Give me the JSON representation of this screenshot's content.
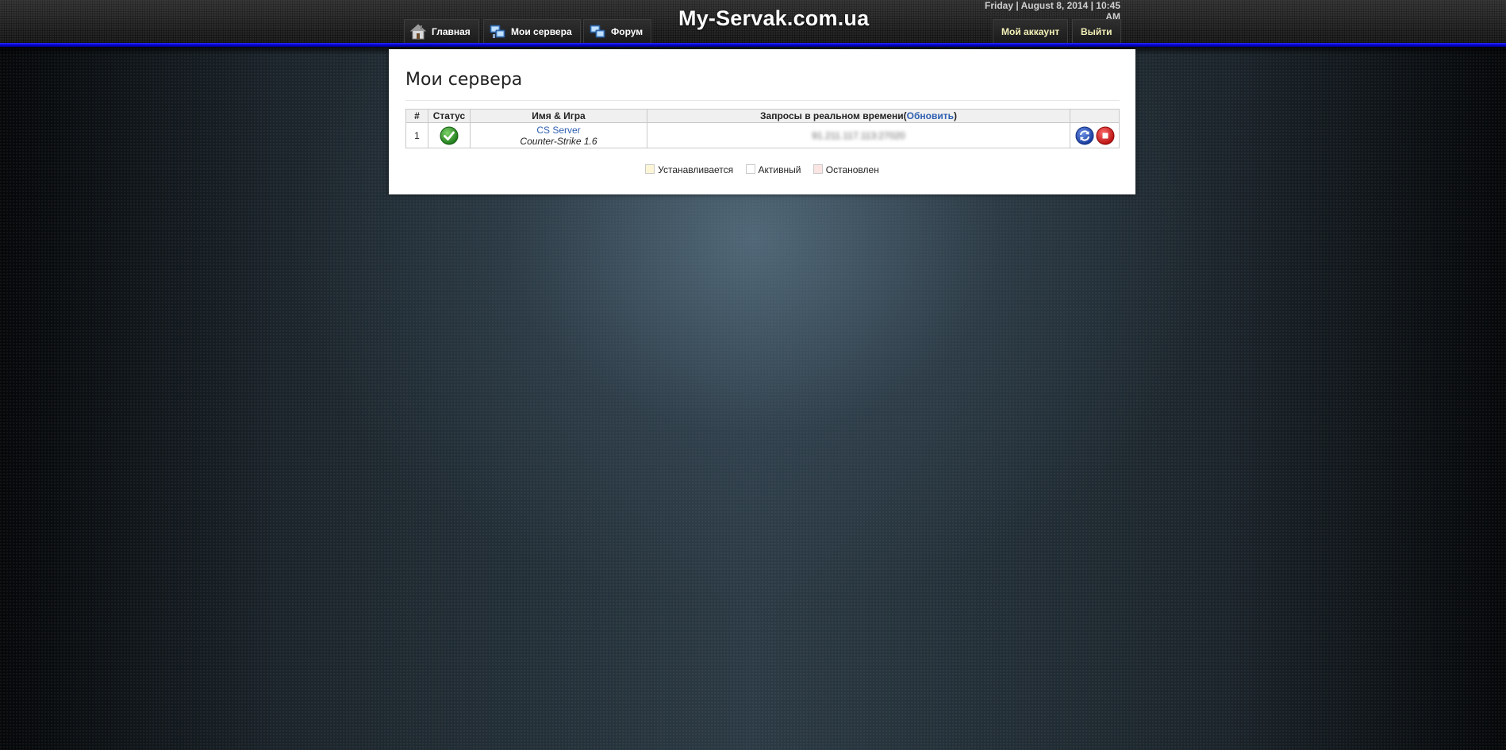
{
  "nav": {
    "home_label": "Главная",
    "servers_label": "Мои сервера",
    "forum_label": "Форум",
    "account_label": "Мой аккаунт",
    "logout_label": "Выйти"
  },
  "site": {
    "logo": "My-Servak.com.ua",
    "datetime": "Friday | August 8, 2014 | 10:45 AM"
  },
  "page": {
    "title": "Мои сервера"
  },
  "table": {
    "headers": {
      "num": "#",
      "status": "Статус",
      "name_game": "Имя & Игра",
      "queries": "Запросы в реальном времени(",
      "refresh": "Обновить",
      "queries_close": ")"
    },
    "rows": [
      {
        "num": "1",
        "status": "active",
        "name": "CS Server",
        "game": "Counter-Strike 1.6",
        "address": "91.211.117.113:27020"
      }
    ]
  },
  "legend": {
    "installing": "Устанавливается",
    "active": "Активный",
    "stopped": "Остановлен"
  },
  "colors": {
    "accent_blue": "#0000c8",
    "link": "#2e5fb1",
    "installing_swatch": "#fdf6d6",
    "active_swatch": "#ffffff",
    "stopped_swatch": "#fbe4e4"
  },
  "icons": {
    "home": "house-icon",
    "servers": "servers-icon",
    "forum": "forum-icon",
    "status": "check-circle-icon",
    "restart": "restart-icon",
    "stop": "stop-icon"
  }
}
